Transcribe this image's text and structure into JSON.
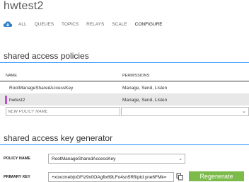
{
  "header": {
    "title": "hwtest2"
  },
  "nav": {
    "icon": "cloud-icon",
    "items": [
      {
        "label": "ALL",
        "active": false
      },
      {
        "label": "QUEUES",
        "active": false
      },
      {
        "label": "TOPICS",
        "active": false
      },
      {
        "label": "RELAYS",
        "active": false
      },
      {
        "label": "SCALE",
        "active": false
      },
      {
        "label": "CONFIGURE",
        "active": true
      }
    ]
  },
  "policies": {
    "title": "shared access policies",
    "columns": {
      "name": "NAME",
      "permissions": "PERMISSIONS"
    },
    "rows": [
      {
        "name": "RootManageSharedAccessKey",
        "permissions": "Manage, Send, Listen",
        "selected": false
      },
      {
        "name": "hwtest2",
        "permissions": "Manage, Send, Listen",
        "selected": true
      }
    ],
    "new_policy_placeholder": "NEW POLICY NAME",
    "permissions_value": ""
  },
  "generator": {
    "title": "shared access key generator",
    "policy_label": "POLICY NAME",
    "policy_value": "RootManageSharedAccessKey",
    "primary_key_label": "PRIMARY KEY",
    "primary_key_value": "+xoxcmeb|oGFiz9x0OAgfix69LFo4sn5RfIiptd.yne6FMk=",
    "regenerate_label": "Regenerate"
  },
  "colors": {
    "accent_rule": "#1e90ff",
    "selected_marker": "#b855c8",
    "regenerate_button": "#7cba4a"
  }
}
